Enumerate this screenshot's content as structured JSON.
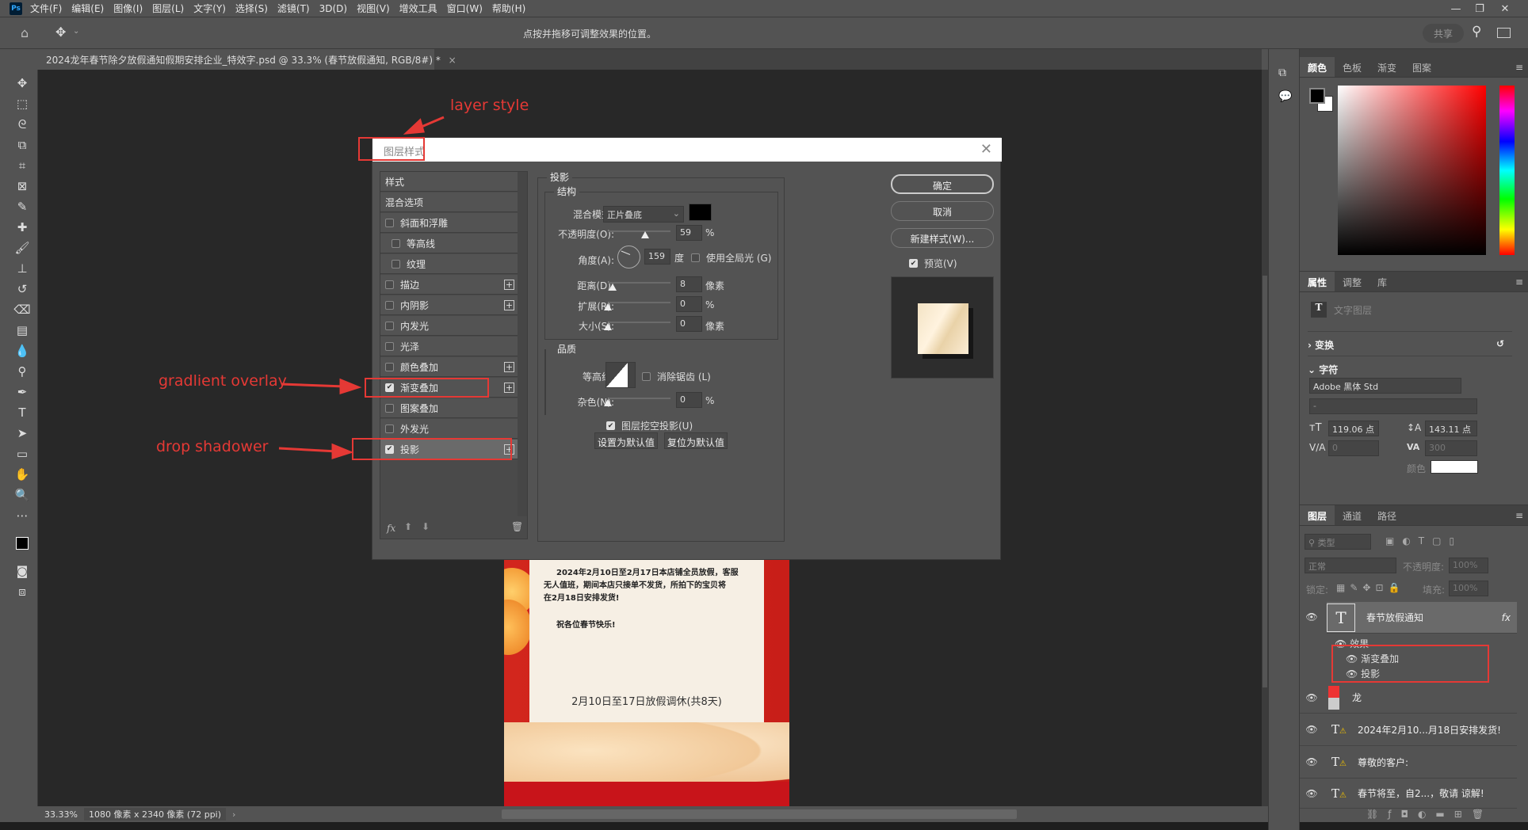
{
  "menubar": {
    "logo": "Ps",
    "items": [
      "文件(F)",
      "编辑(E)",
      "图像(I)",
      "图层(L)",
      "文字(Y)",
      "选择(S)",
      "滤镜(T)",
      "3D(D)",
      "视图(V)",
      "增效工具",
      "窗口(W)",
      "帮助(H)"
    ]
  },
  "options": {
    "hint": "点按并拖移可调整效果的位置。",
    "share": "共享"
  },
  "document": {
    "tab_title": "2024龙年春节除夕放假通知假期安排企业_特效字.psd @ 33.3% (春节放假通知, RGB/8#) *",
    "tab_close": "×"
  },
  "status": {
    "zoom": "33.33%",
    "info": "1080 像素 x 2340 像素 (72 ppi)"
  },
  "canvas_text": {
    "para1_l1": "2024年2月10日至2月17日本店铺全员放假，客服",
    "para1_l2": "无人值班，期间本店只接单不发货，所拍下的宝贝将",
    "para1_l3": "在2月18日安排发货!",
    "greeting": "祝各位春节快乐!",
    "headline": "2月10日至17日放假调休(共8天)"
  },
  "dialog": {
    "title": "图层样式",
    "styles": [
      {
        "label": "样式",
        "checkbox": false,
        "header": true
      },
      {
        "label": "混合选项",
        "checkbox": false,
        "header": true
      },
      {
        "label": "斜面和浮雕",
        "checked": false
      },
      {
        "label": "等高线",
        "checked": false,
        "indent": true
      },
      {
        "label": "纹理",
        "checked": false,
        "indent": true
      },
      {
        "label": "描边",
        "checked": false,
        "plus": true
      },
      {
        "label": "内阴影",
        "checked": false,
        "plus": true
      },
      {
        "label": "内发光",
        "checked": false
      },
      {
        "label": "光泽",
        "checked": false
      },
      {
        "label": "颜色叠加",
        "checked": false,
        "plus": true
      },
      {
        "label": "渐变叠加",
        "checked": true,
        "plus": true
      },
      {
        "label": "图案叠加",
        "checked": false
      },
      {
        "label": "外发光",
        "checked": false
      },
      {
        "label": "投影",
        "checked": true,
        "plus": true,
        "selected": true
      }
    ],
    "section": "投影",
    "structure": {
      "legend": "结构",
      "blend_label": "混合模式:",
      "blend_value": "正片叠底",
      "shadow_color": "#000000",
      "opacity_label": "不透明度(O):",
      "opacity": "59",
      "opacity_unit": "%",
      "angle_label": "角度(A):",
      "angle": "159",
      "angle_unit": "度",
      "global_light": "使用全局光 (G)",
      "global_light_checked": false,
      "distance_label": "距离(D):",
      "distance": "8",
      "distance_unit": "像素",
      "spread_label": "扩展(R):",
      "spread": "0",
      "spread_unit": "%",
      "size_label": "大小(S):",
      "size": "0",
      "size_unit": "像素"
    },
    "quality": {
      "legend": "品质",
      "contour_label": "等高线:",
      "antialias": "消除锯齿 (L)",
      "antialias_checked": false,
      "noise_label": "杂色(N):",
      "noise": "0",
      "noise_unit": "%"
    },
    "knockout": "图层挖空投影(U)",
    "knockout_checked": true,
    "make_default": "设置为默认值",
    "reset_default": "复位为默认值",
    "ok": "确定",
    "cancel": "取消",
    "new_style": "新建样式(W)...",
    "preview": "预览(V)",
    "preview_checked": true,
    "footer_fx": "fx"
  },
  "annotations": {
    "layer_style": "layer style",
    "gradient_overlay": "gradlient overlay",
    "drop_shadow": "drop shadower",
    "color": "#e53935"
  },
  "color_panel": {
    "tabs": [
      "颜色",
      "色板",
      "渐变",
      "图案"
    ],
    "foreground": "#000000",
    "background": "#ffffff",
    "hue": "#ff0000"
  },
  "properties": {
    "tabs": [
      "属性",
      "调整",
      "库"
    ],
    "layer_type": "文字图层",
    "transform": "变换",
    "character": "字符",
    "font": "Adobe 黑体 Std",
    "font_style": "-",
    "size": "119.06 点",
    "leading": "143.11 点",
    "kerning": "0",
    "tracking": "300",
    "color_label": "颜色",
    "text_color": "#ffffff"
  },
  "layers": {
    "tabs": [
      "图层",
      "通道",
      "路径"
    ],
    "filter": "类型",
    "blend": "正常",
    "opacity_label": "不透明度:",
    "opacity": "100%",
    "lock_label": "锁定:",
    "fill_label": "填充:",
    "fill": "100%",
    "items": [
      {
        "name": "春节放假通知",
        "type": "text",
        "fx": "fx",
        "selected": true
      },
      {
        "name": "龙",
        "type": "smart"
      },
      {
        "name": "2024年2月10...月18日安排发货!",
        "type": "text-warn"
      },
      {
        "name": "尊敬的客户:",
        "type": "text-warn"
      },
      {
        "name": "春节将至，自2...，敬请 谅解!",
        "type": "text-warn"
      }
    ],
    "effects_label": "效果",
    "effects": [
      "渐变叠加",
      "投影"
    ]
  }
}
